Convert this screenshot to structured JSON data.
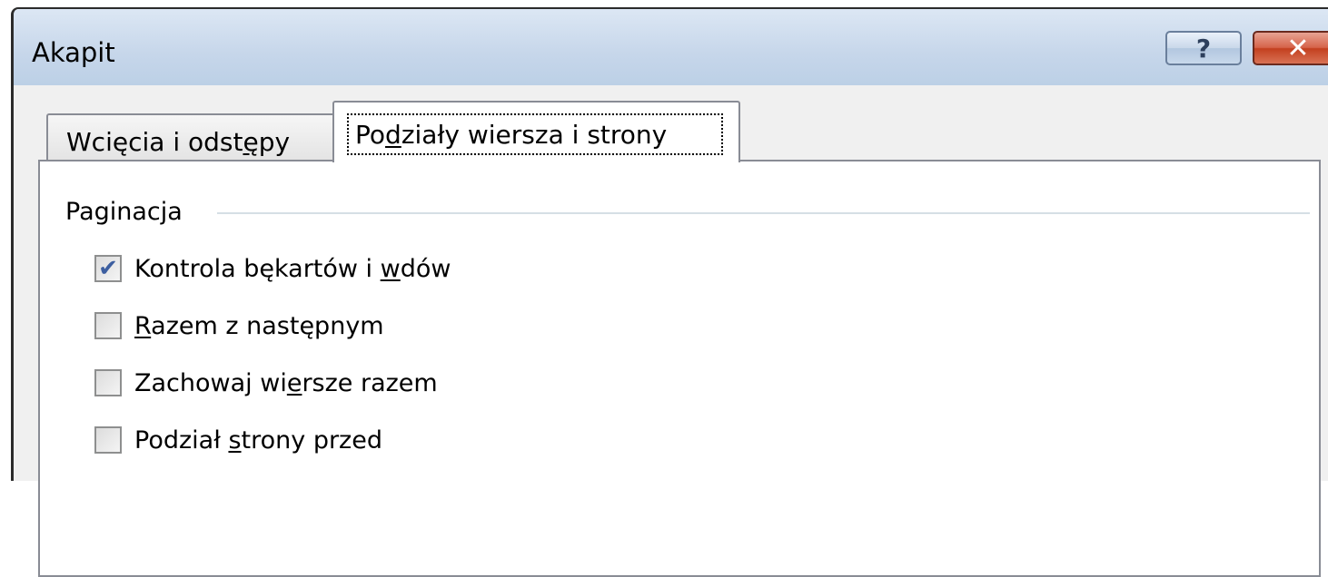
{
  "window": {
    "title": "Akapit",
    "help_glyph": "?",
    "close_glyph": "✕"
  },
  "tabs": [
    {
      "label_pre": "Wcięcia i odst",
      "label_key": "ę",
      "label_post": "py",
      "selected": false
    },
    {
      "label_pre": "Po",
      "label_key": "d",
      "label_post": "ziały wiersza i strony",
      "selected": true
    }
  ],
  "pagination": {
    "group_label": "Paginacja",
    "options": [
      {
        "pre": "Kontrola bękartów i ",
        "key": "w",
        "post": "dów",
        "checked": true
      },
      {
        "pre": "",
        "key": "R",
        "post": "azem z następnym",
        "checked": false
      },
      {
        "pre": "Zachowaj wi",
        "key": "e",
        "post": "rsze razem",
        "checked": false
      },
      {
        "pre": "Podział ",
        "key": "s",
        "post": "trony przed",
        "checked": false
      }
    ]
  },
  "check_glyph": "✔",
  "colors": {
    "titlebar": "#c6d6ea",
    "close_button": "#c3401f",
    "checkmark": "#3c5ea0",
    "face": "#f0f0f0"
  }
}
